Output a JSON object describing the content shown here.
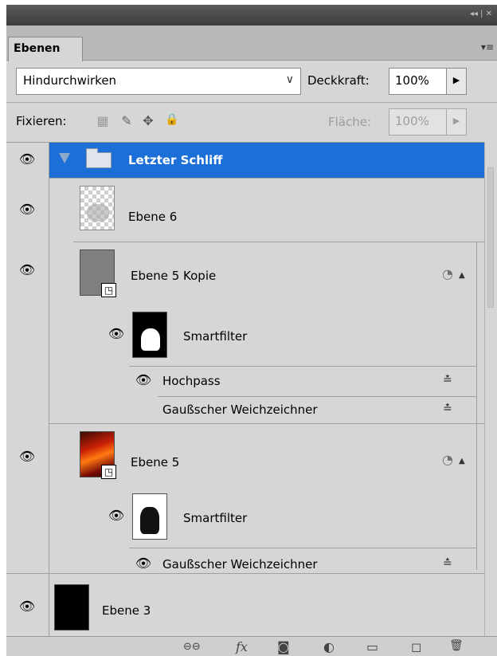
{
  "panel": {
    "tab_label": "Ebenen",
    "blend_mode": "Hindurchwirken",
    "opacity_label": "Deckkraft:",
    "opacity_value": "100%",
    "lock_label": "Fixieren:",
    "fill_label": "Fläche:",
    "fill_value": "100%",
    "title_controls": "◂◂ | ✕",
    "menu_icon": "panel-menu-icon"
  },
  "layers": {
    "group_name": "Letzter Schliff",
    "ebene6": "Ebene 6",
    "ebene5kopie": "Ebene 5 Kopie",
    "smartfilter_a": "Smartfilter",
    "hochpass": "Hochpass",
    "gauss_a": "Gaußscher Weichzeichner",
    "ebene5": "Ebene 5",
    "smartfilter_b": "Smartfilter",
    "gauss_b": "Gaußscher Weichzeichner",
    "ebene3": "Ebene 3"
  },
  "icons": {
    "eye": "👁",
    "up": "▲",
    "right": "▶",
    "down": "∨",
    "filter_options": "≛",
    "link": "⊖⊖",
    "fx": "fx",
    "mask": "◙",
    "adjust": "◐",
    "folder": "▭",
    "new": "◻",
    "trash": "🗑",
    "lock_pixels": "▦",
    "lock_paint": "✎",
    "lock_move": "✥",
    "lock_all": "🔒",
    "smart_obj": "◳",
    "filter_icon": "◔"
  }
}
